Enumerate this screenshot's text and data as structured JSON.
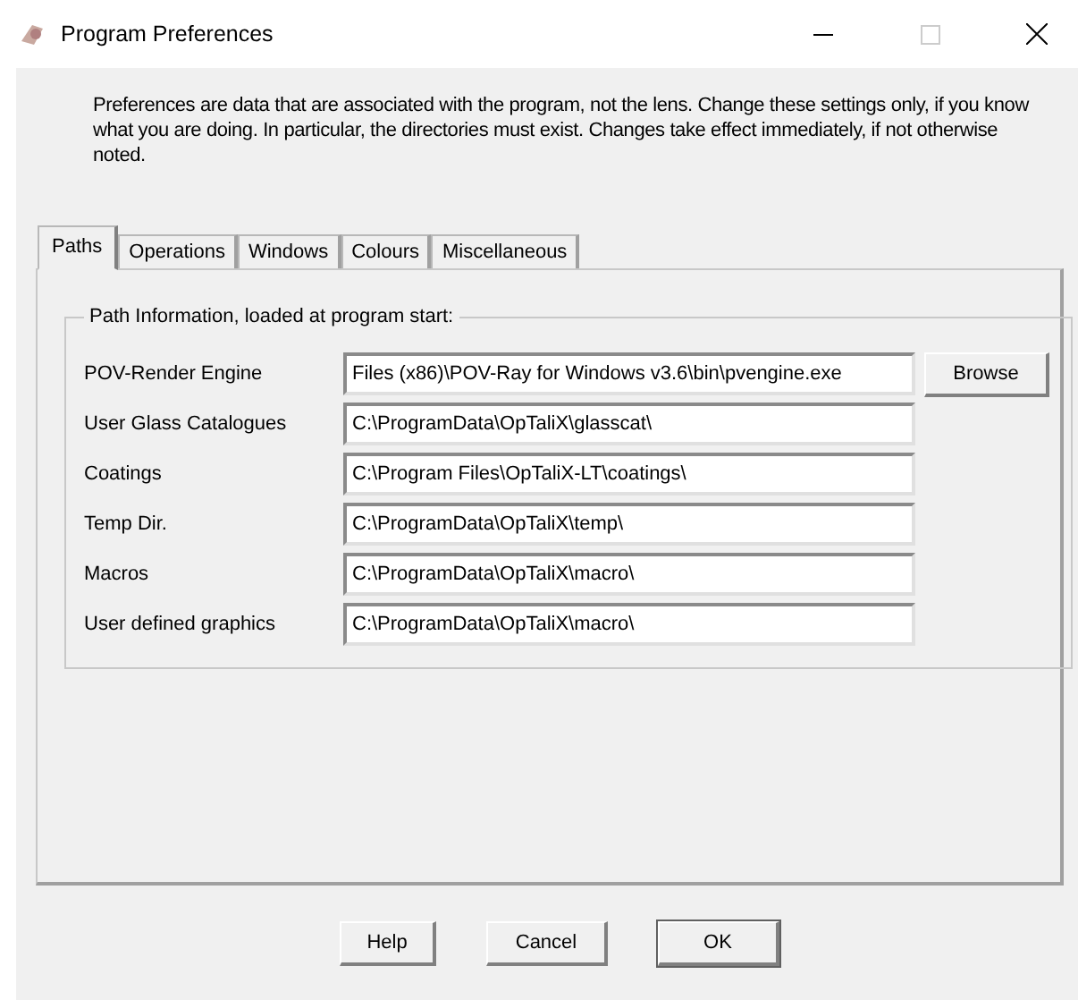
{
  "window": {
    "title": "Program Preferences"
  },
  "description": "Preferences are data that are associated with the program, not the lens. Change these settings only, if you know what you are doing. In particular, the directories must exist. Changes take effect immediately, if not otherwise noted.",
  "tabs": [
    {
      "label": "Paths",
      "selected": true
    },
    {
      "label": "Operations",
      "selected": false
    },
    {
      "label": "Windows",
      "selected": false
    },
    {
      "label": "Colours",
      "selected": false
    },
    {
      "label": "Miscellaneous",
      "selected": false
    }
  ],
  "group": {
    "title": "Path Information, loaded at program start:",
    "fields": [
      {
        "label": "POV-Render Engine",
        "value": "Files (x86)\\POV-Ray for Windows v3.6\\bin\\pvengine.exe",
        "button": "Browse"
      },
      {
        "label": "User Glass Catalogues",
        "value": "C:\\ProgramData\\OpTaliX\\glasscat\\"
      },
      {
        "label": "Coatings",
        "value": "C:\\Program Files\\OpTaliX-LT\\coatings\\"
      },
      {
        "label": "Temp Dir.",
        "value": "C:\\ProgramData\\OpTaliX\\temp\\"
      },
      {
        "label": "Macros",
        "value": "C:\\ProgramData\\OpTaliX\\macro\\"
      },
      {
        "label": "User defined graphics",
        "value": "C:\\ProgramData\\OpTaliX\\macro\\"
      }
    ]
  },
  "buttons": [
    {
      "label": "Help",
      "default": false
    },
    {
      "label": "Cancel",
      "default": false
    },
    {
      "label": "OK",
      "default": true
    }
  ]
}
